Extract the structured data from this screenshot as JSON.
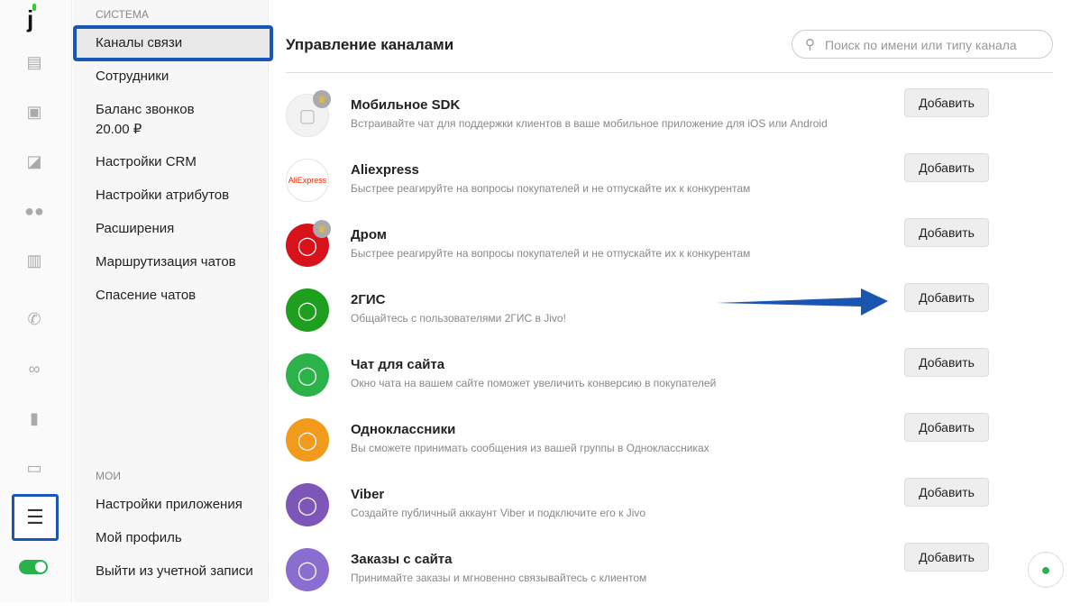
{
  "rail": {
    "icons": [
      "chat-icon",
      "contacts-icon",
      "presentation-icon",
      "team-icon",
      "analytics-plus-icon",
      "phone-icon",
      "binoculars-icon",
      "stats-icon",
      "card-icon",
      "settings-sliders-icon"
    ]
  },
  "sidebar": {
    "section_system": "СИСТЕМА",
    "items": [
      "Каналы связи",
      "Сотрудники",
      "Баланс звонков",
      "Настройки CRM",
      "Настройки атрибутов",
      "Расширения",
      "Маршрутизация чатов",
      "Спасение чатов"
    ],
    "balance": "20.00 ₽",
    "section_mine": "МОИ",
    "mine_items": [
      "Настройки приложения",
      "Мой профиль",
      "Выйти из учетной записи"
    ]
  },
  "main": {
    "title": "Управление каналами",
    "search_placeholder": "Поиск по имени или типу канала",
    "button_label": "Добавить",
    "channels": [
      {
        "name": "Мобильное SDK",
        "desc": "Встраивайте чат для поддержки клиентов в ваше мобильное приложение для iOS или Android",
        "color": "#f2f2f2",
        "premium": true
      },
      {
        "name": "Aliexpress",
        "desc": "Быстрее реагируйте на вопросы покупателей и не отпускайте их к конкурентам",
        "color": "#ffffff",
        "logo": "AliExpress",
        "premium": false
      },
      {
        "name": "Дром",
        "desc": "Быстрее реагируйте на вопросы покупателей и не отпускайте их к конкурентам",
        "color": "#d8121b",
        "premium": true
      },
      {
        "name": "2ГИС",
        "desc": "Общайтесь с пользователями 2ГИС в Jivo!",
        "color": "#1ea01e",
        "premium": false
      },
      {
        "name": "Чат для сайта",
        "desc": "Окно чата на вашем сайте поможет увеличить конверсию в покупателей",
        "color": "#2bb34a",
        "premium": false
      },
      {
        "name": "Одноклассники",
        "desc": "Вы сможете принимать сообщения из вашей группы в Одноклассниках",
        "color": "#f29a1b",
        "premium": false
      },
      {
        "name": "Viber",
        "desc": "Создайте публичный аккаунт Viber и подключите его к Jivo",
        "color": "#7d56b8",
        "premium": false
      },
      {
        "name": "Заказы с сайта",
        "desc": "Принимайте заказы и мгновенно связывайтесь с клиентом",
        "color": "#8b6dd0",
        "premium": false
      }
    ]
  }
}
